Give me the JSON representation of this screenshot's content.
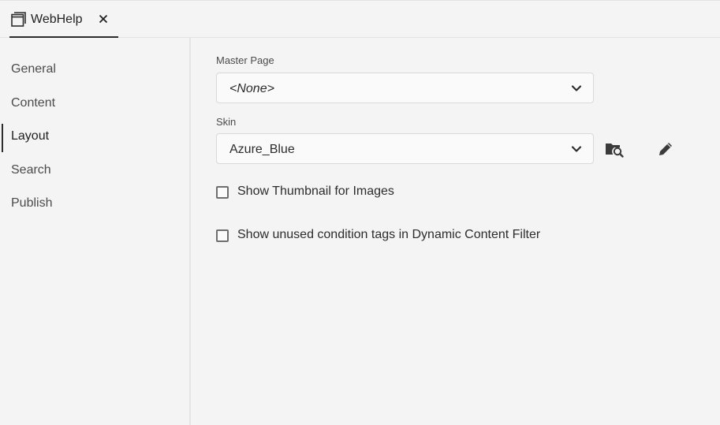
{
  "tab": {
    "title": "WebHelp",
    "icon": "window-icon",
    "close_icon": "close-icon"
  },
  "sidebar": {
    "items": [
      {
        "label": "General",
        "active": false
      },
      {
        "label": "Content",
        "active": false
      },
      {
        "label": "Layout",
        "active": true
      },
      {
        "label": "Search",
        "active": false
      },
      {
        "label": "Publish",
        "active": false
      }
    ]
  },
  "main": {
    "master_page": {
      "label": "Master Page",
      "value": "<None>"
    },
    "skin": {
      "label": "Skin",
      "value": "Azure_Blue",
      "browse_icon": "folder-search-icon",
      "edit_icon": "pencil-icon"
    },
    "options": [
      {
        "label": "Show Thumbnail for Images",
        "checked": false
      },
      {
        "label": "Show unused condition tags in Dynamic Content Filter",
        "checked": false
      }
    ]
  },
  "colors": {
    "background": "#f4f4f4",
    "text": "#2c2c2c",
    "border": "#d9d9d9"
  }
}
